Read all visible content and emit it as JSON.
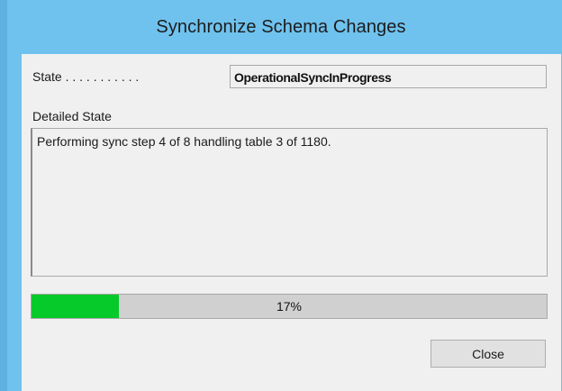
{
  "window": {
    "title": "Synchronize Schema Changes"
  },
  "state": {
    "label": "State . . . . . . . . . . .",
    "value": "OperationalSyncInProgress"
  },
  "detailed_state": {
    "label": "Detailed State",
    "text": "Performing sync step 4 of 8 handling table 3 of 1180."
  },
  "progress": {
    "value": 0.17,
    "label": "17%",
    "fill_color": "#06c92a"
  },
  "buttons": {
    "close_label": "Close"
  }
}
